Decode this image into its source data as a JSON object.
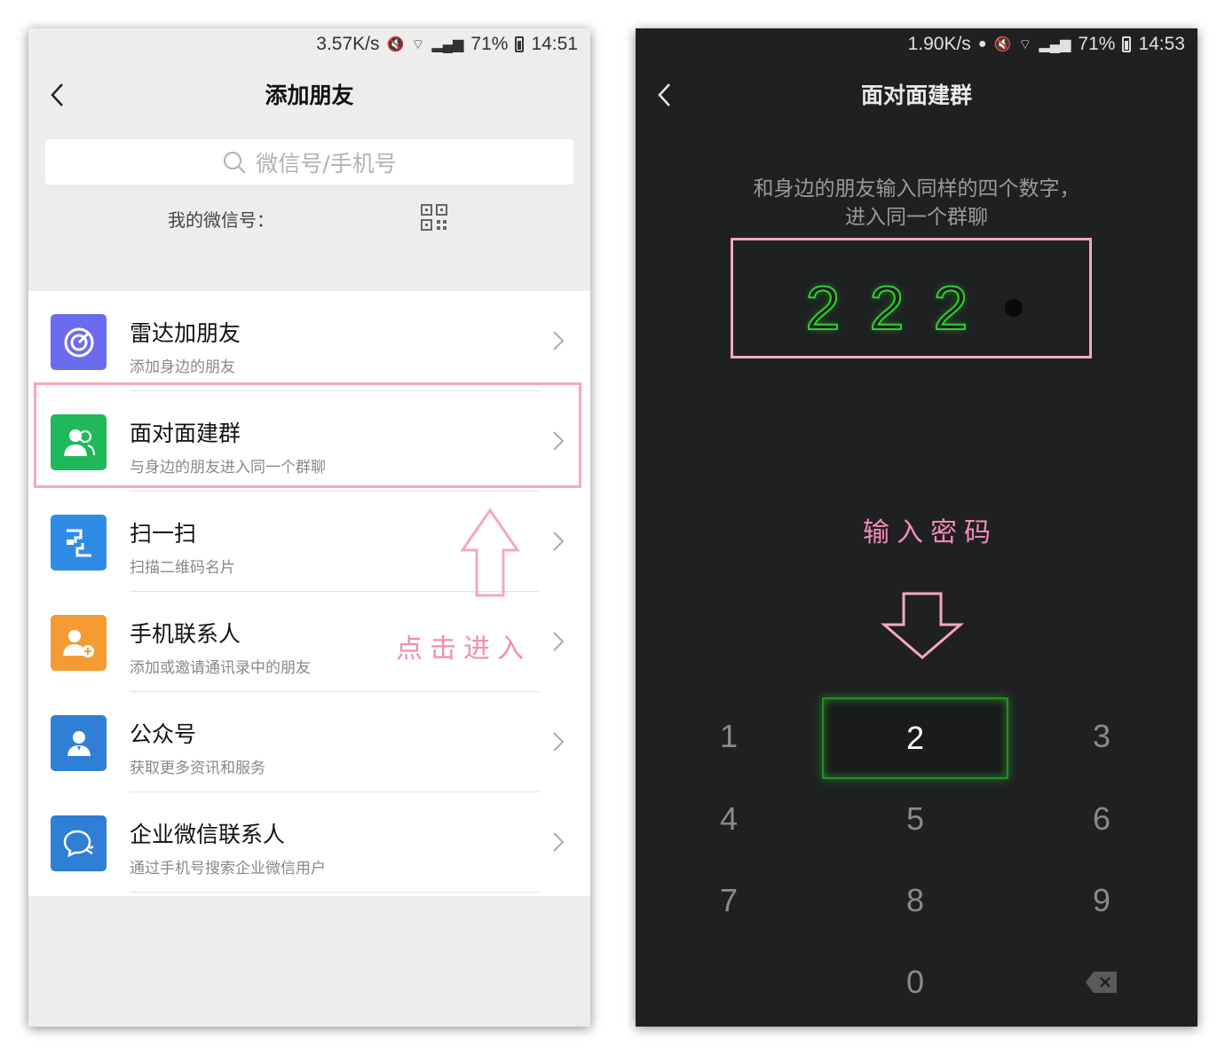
{
  "left": {
    "status": {
      "speed": "3.57K/s",
      "battery": "71%",
      "time": "14:51"
    },
    "title": "添加朋友",
    "search_placeholder": "微信号/手机号",
    "my_id_label": "我的微信号：",
    "items": [
      {
        "title": "雷达加朋友",
        "subtitle": "添加身边的朋友",
        "icon": "radar-icon",
        "color": "#6b6bf0"
      },
      {
        "title": "面对面建群",
        "subtitle": "与身边的朋友进入同一个群聊",
        "icon": "group-people-icon",
        "color": "#20b85a"
      },
      {
        "title": "扫一扫",
        "subtitle": "扫描二维码名片",
        "icon": "scan-icon",
        "color": "#2f8ce6"
      },
      {
        "title": "手机联系人",
        "subtitle": "添加或邀请通讯录中的朋友",
        "icon": "contact-add-icon",
        "color": "#f49b33"
      },
      {
        "title": "公众号",
        "subtitle": "获取更多资讯和服务",
        "icon": "official-account-icon",
        "color": "#2f7fd6"
      },
      {
        "title": "企业微信联系人",
        "subtitle": "通过手机号搜索企业微信用户",
        "icon": "enterprise-chat-icon",
        "color": "#2f7fd6"
      }
    ],
    "annotation": "点击进入"
  },
  "right": {
    "status": {
      "speed": "1.90K/s",
      "battery": "71%",
      "time": "14:53"
    },
    "title": "面对面建群",
    "prompt_line1": "和身边的朋友输入同样的四个数字，",
    "prompt_line2": "进入同一个群聊",
    "entered": [
      "2",
      "2",
      "2"
    ],
    "annotation": "输入密码",
    "keys": [
      "1",
      "2",
      "3",
      "4",
      "5",
      "6",
      "7",
      "8",
      "9",
      "0"
    ],
    "active_key": "2"
  }
}
